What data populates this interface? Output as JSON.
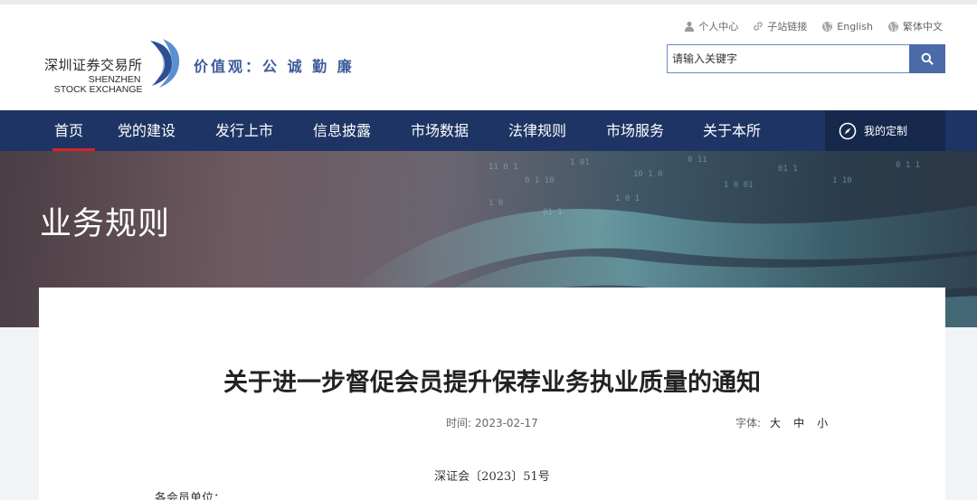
{
  "header": {
    "logo_cn": "深圳证券交易所",
    "logo_en_line1": "SHENZHEN",
    "logo_en_line2": "STOCK EXCHANGE",
    "slogan": "价值观：公 诚 勤 廉",
    "top_links": [
      {
        "label": "个人中心",
        "icon": "person-icon"
      },
      {
        "label": "子站链接",
        "icon": "link-icon"
      },
      {
        "label": "English",
        "icon": "globe-icon"
      },
      {
        "label": "繁体中文",
        "icon": "globe-icon"
      }
    ],
    "search_placeholder": "请输入关键字"
  },
  "nav": {
    "items": [
      {
        "label": "首页",
        "active": true
      },
      {
        "label": "党的建设"
      },
      {
        "label": "发行上市"
      },
      {
        "label": "信息披露"
      },
      {
        "label": "市场数据"
      },
      {
        "label": "法律规则"
      },
      {
        "label": "市场服务"
      },
      {
        "label": "关于本所"
      }
    ],
    "custom_label": "我的定制"
  },
  "banner": {
    "title": "业务规则"
  },
  "article": {
    "title": "关于进一步督促会员提升保荐业务执业质量的通知",
    "time_label": "时间:",
    "time_value": "2023-02-17",
    "font_label": "字体:",
    "font_options": [
      "大",
      "中",
      "小"
    ],
    "doc_number": "深证会〔2023〕51号",
    "addressee": "各会员单位："
  },
  "colors": {
    "nav_bg": "#1e3464",
    "nav_active": "#d8232a",
    "accent": "#4a6aa8",
    "slogan": "#3b5b9a"
  }
}
